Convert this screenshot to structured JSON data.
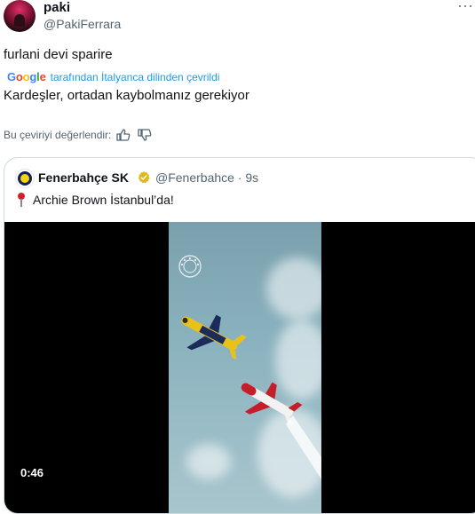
{
  "tweet": {
    "author_name": "paki",
    "author_handle": "@PakiFerrara",
    "original_text": "furlani devi sparire",
    "translation_note": "tarafından İtalyanca dilinden çevrildi",
    "translation_provider": "Google",
    "translated_text": "Kardeşler, ortadan kaybolmanız gerekiyor",
    "rate_translation_label": "Bu çeviriyi değerlendir:"
  },
  "quoted": {
    "author_name": "Fenerbahçe SK",
    "author_handle": "@Fenerbahce · 9s",
    "text": "Archie Brown İstanbul’da!",
    "video_time": "0:46"
  },
  "colors": {
    "link": "#1d9bf0",
    "muted": "#536471",
    "verified_gold": "#e2b719"
  },
  "icons": [
    "more-icon",
    "thumbs-up-icon",
    "thumbs-down-icon",
    "verified-badge-icon",
    "pin-icon"
  ]
}
